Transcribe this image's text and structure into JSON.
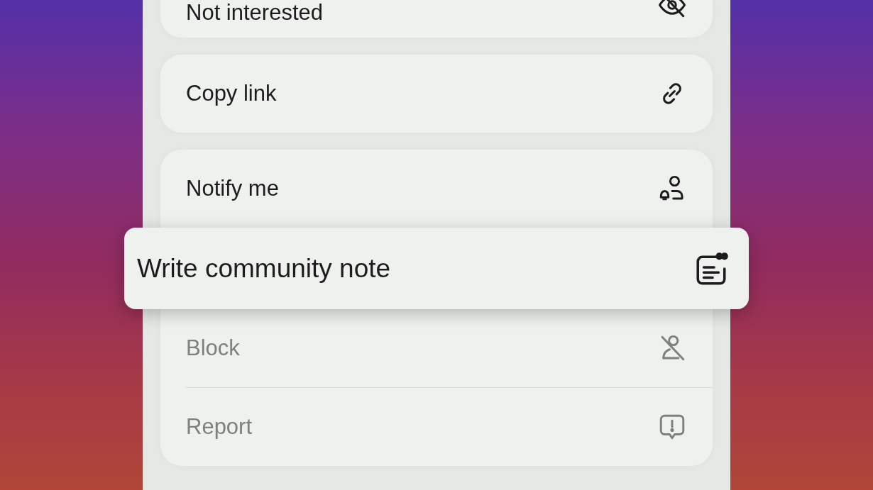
{
  "menu": {
    "groups": [
      {
        "items": [
          {
            "label": "Not interested",
            "pressed": false,
            "dimmed": false
          }
        ]
      },
      {
        "items": [
          {
            "label": "Copy link",
            "pressed": false,
            "dimmed": false
          }
        ]
      },
      {
        "items": [
          {
            "label": "Notify me",
            "pressed": false,
            "dimmed": false
          },
          {
            "label": "Write community note",
            "pressed": true,
            "dimmed": false
          },
          {
            "label": "Block",
            "pressed": false,
            "dimmed": true
          },
          {
            "label": "Report",
            "pressed": false,
            "dimmed": true
          }
        ]
      }
    ]
  }
}
